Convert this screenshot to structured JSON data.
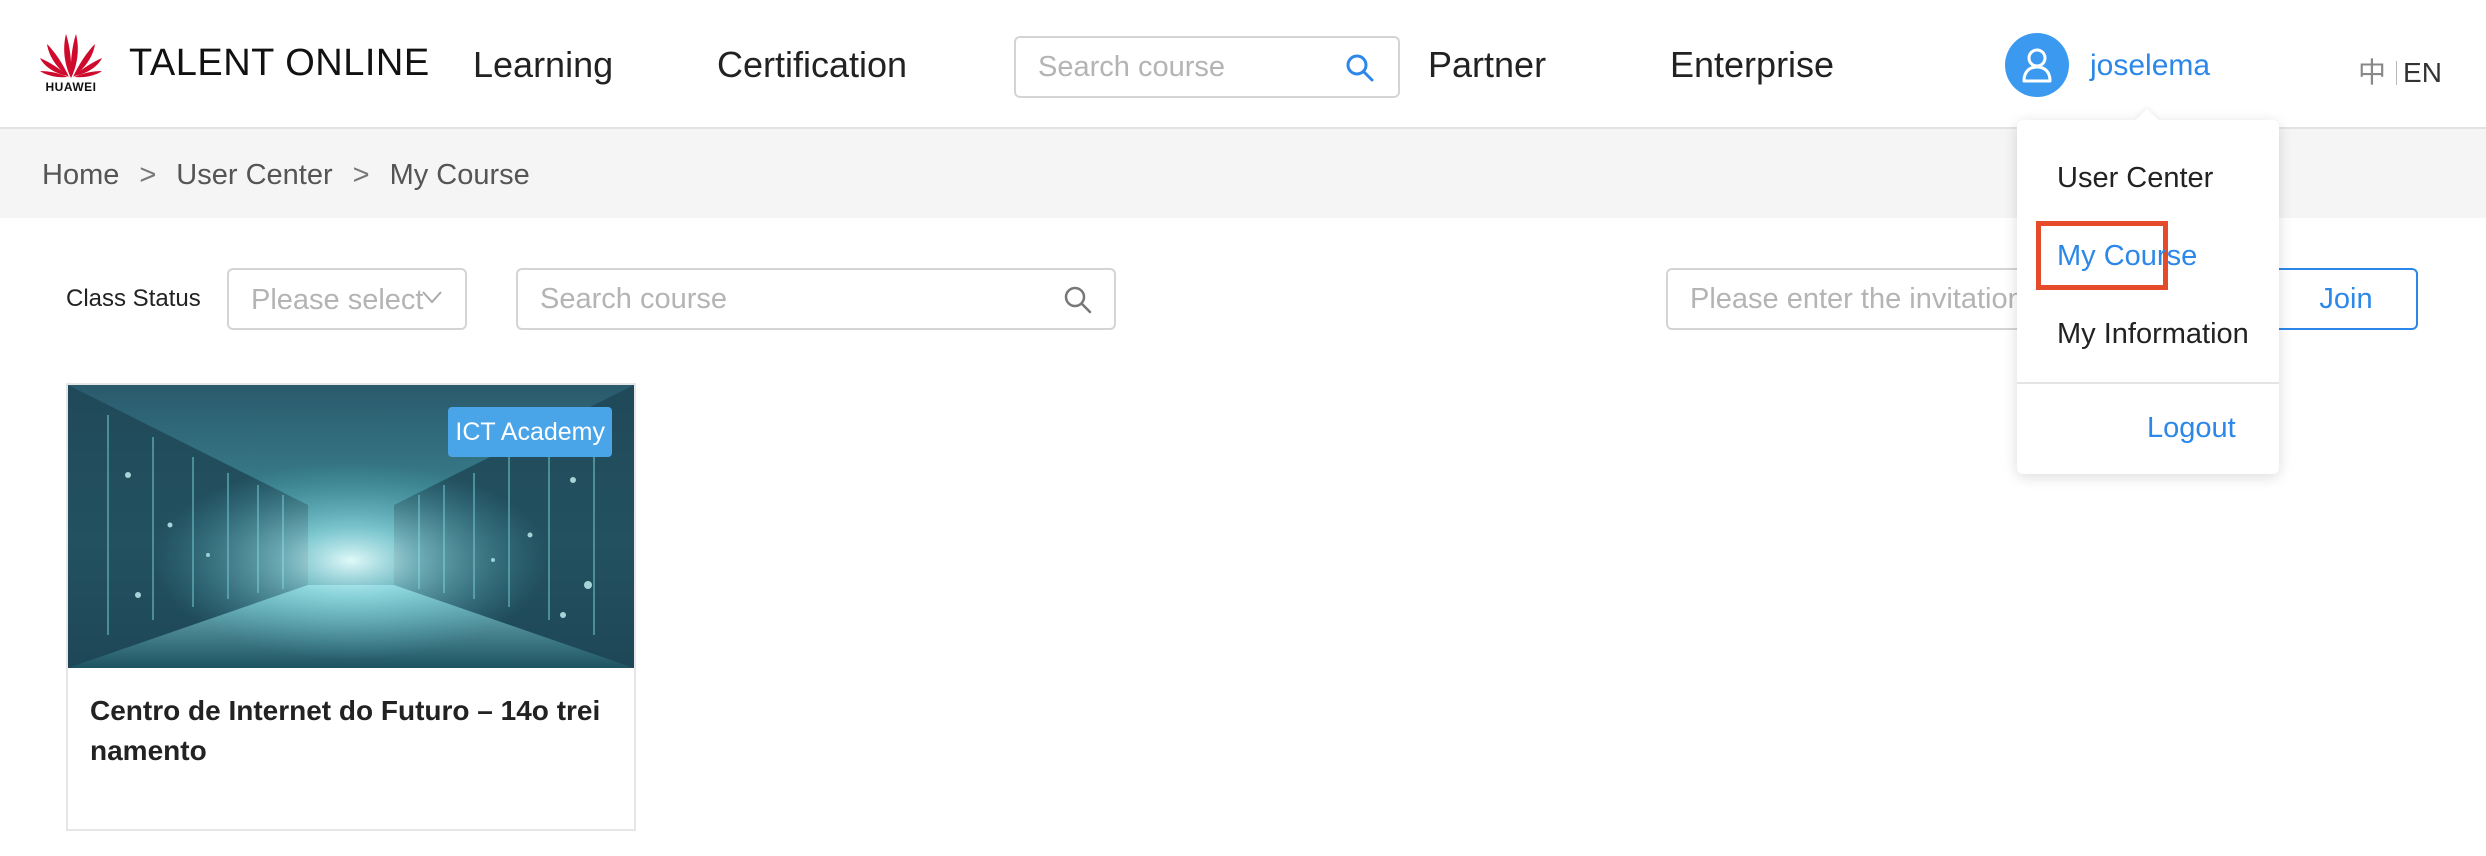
{
  "header": {
    "logo_text": "HUAWEI",
    "brand": "TALENT ONLINE",
    "nav": {
      "learning": "Learning",
      "certification": "Certification",
      "partner": "Partner",
      "enterprise": "Enterprise"
    },
    "search_placeholder": "Search course",
    "username": "joselema",
    "lang_zh": "中",
    "lang_en": "EN"
  },
  "breadcrumb": {
    "home": "Home",
    "separator": ">",
    "user_center": "User Center",
    "current": "My Course"
  },
  "filters": {
    "class_status_label": "Class Status",
    "class_status_placeholder": "Please select",
    "search_placeholder": "Search course",
    "invitation_placeholder": "Please enter the invitation code",
    "join_label": "Join"
  },
  "courses": [
    {
      "badge": "ICT Academy",
      "title": "Centro de Internet do Futuro – 14o treinamento"
    }
  ],
  "user_menu": {
    "items": [
      "User Center",
      "My Course",
      "My Information"
    ],
    "active": "My Course",
    "logout": "Logout"
  },
  "colors": {
    "accent": "#2c87e8",
    "avatar": "#3b9af0",
    "badge": "#4aa4e8",
    "highlight_border": "#e54b2a",
    "logo_red": "#cf0a2c"
  },
  "icons": {
    "logo": "huawei-petal-logo",
    "search": "search-icon",
    "user": "user-icon",
    "select": "chevron-down-icon"
  }
}
